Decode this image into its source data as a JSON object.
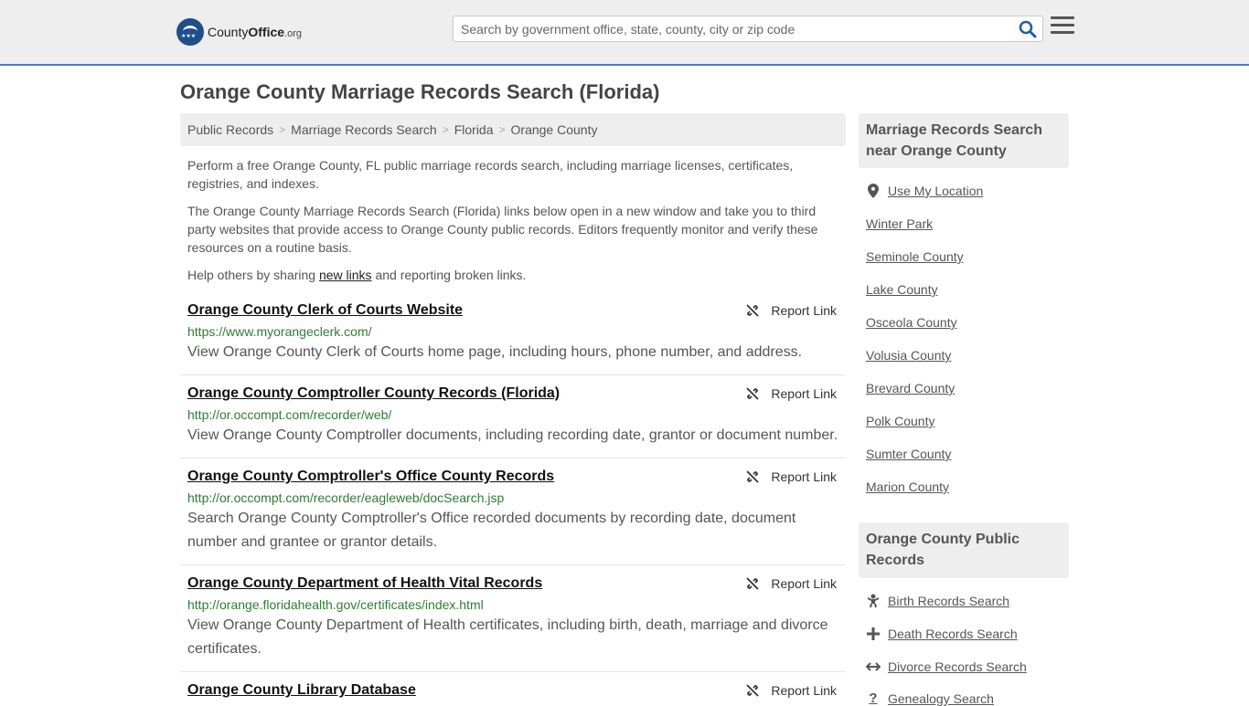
{
  "header": {
    "logo_county": "County",
    "logo_office": "Office",
    "logo_tld": ".org",
    "search_placeholder": "Search by government office, state, county, city or zip code"
  },
  "page": {
    "title": "Orange County Marriage Records Search (Florida)"
  },
  "breadcrumb": [
    "Public Records",
    "Marriage Records Search",
    "Florida",
    "Orange County"
  ],
  "intro": {
    "p1": "Perform a free Orange County, FL public marriage records search, including marriage licenses, certificates, registries, and indexes.",
    "p2": "The Orange County Marriage Records Search (Florida) links below open in a new window and take you to third party websites that provide access to Orange County public records. Editors frequently monitor and verify these resources on a routine basis.",
    "p3_before": "Help others by sharing ",
    "p3_link": "new links",
    "p3_after": " and reporting broken links."
  },
  "report_label": "Report Link",
  "results": [
    {
      "title": "Orange County Clerk of Courts Website",
      "url": "https://www.myorangeclerk.com/",
      "desc": "View Orange County Clerk of Courts home page, including hours, phone number, and address."
    },
    {
      "title": "Orange County Comptroller County Records (Florida)",
      "url": "http://or.occompt.com/recorder/web/",
      "desc": "View Orange County Comptroller documents, including recording date, grantor or document number."
    },
    {
      "title": "Orange County Comptroller's Office County Records",
      "url": "http://or.occompt.com/recorder/eagleweb/docSearch.jsp",
      "desc": "Search Orange County Comptroller's Office recorded documents by recording date, document number and grantee or grantor details."
    },
    {
      "title": "Orange County Department of Health Vital Records",
      "url": "http://orange.floridahealth.gov/certificates/index.html",
      "desc": "View Orange County Department of Health certificates, including birth, death, marriage and divorce certificates."
    },
    {
      "title": "Orange County Library Database",
      "url": "",
      "desc": ""
    }
  ],
  "sidebar": {
    "nearby_title": "Marriage Records Search near Orange County",
    "use_location": "Use My Location",
    "nearby": [
      "Winter Park",
      "Seminole County",
      "Lake County",
      "Osceola County",
      "Volusia County",
      "Brevard County",
      "Polk County",
      "Sumter County",
      "Marion County"
    ],
    "public_title": "Orange County Public Records",
    "public_links": [
      {
        "label": "Birth Records Search",
        "icon": "baby-icon"
      },
      {
        "label": "Death Records Search",
        "icon": "cross-icon"
      },
      {
        "label": "Divorce Records Search",
        "icon": "arrows-icon"
      },
      {
        "label": "Genealogy Search",
        "icon": "question-icon"
      }
    ]
  },
  "colors": {
    "header_bg": "#eeeeee",
    "header_border": "#4a7cc0",
    "url_green": "#2e7d32",
    "search_icon": "#1f5fa8"
  }
}
